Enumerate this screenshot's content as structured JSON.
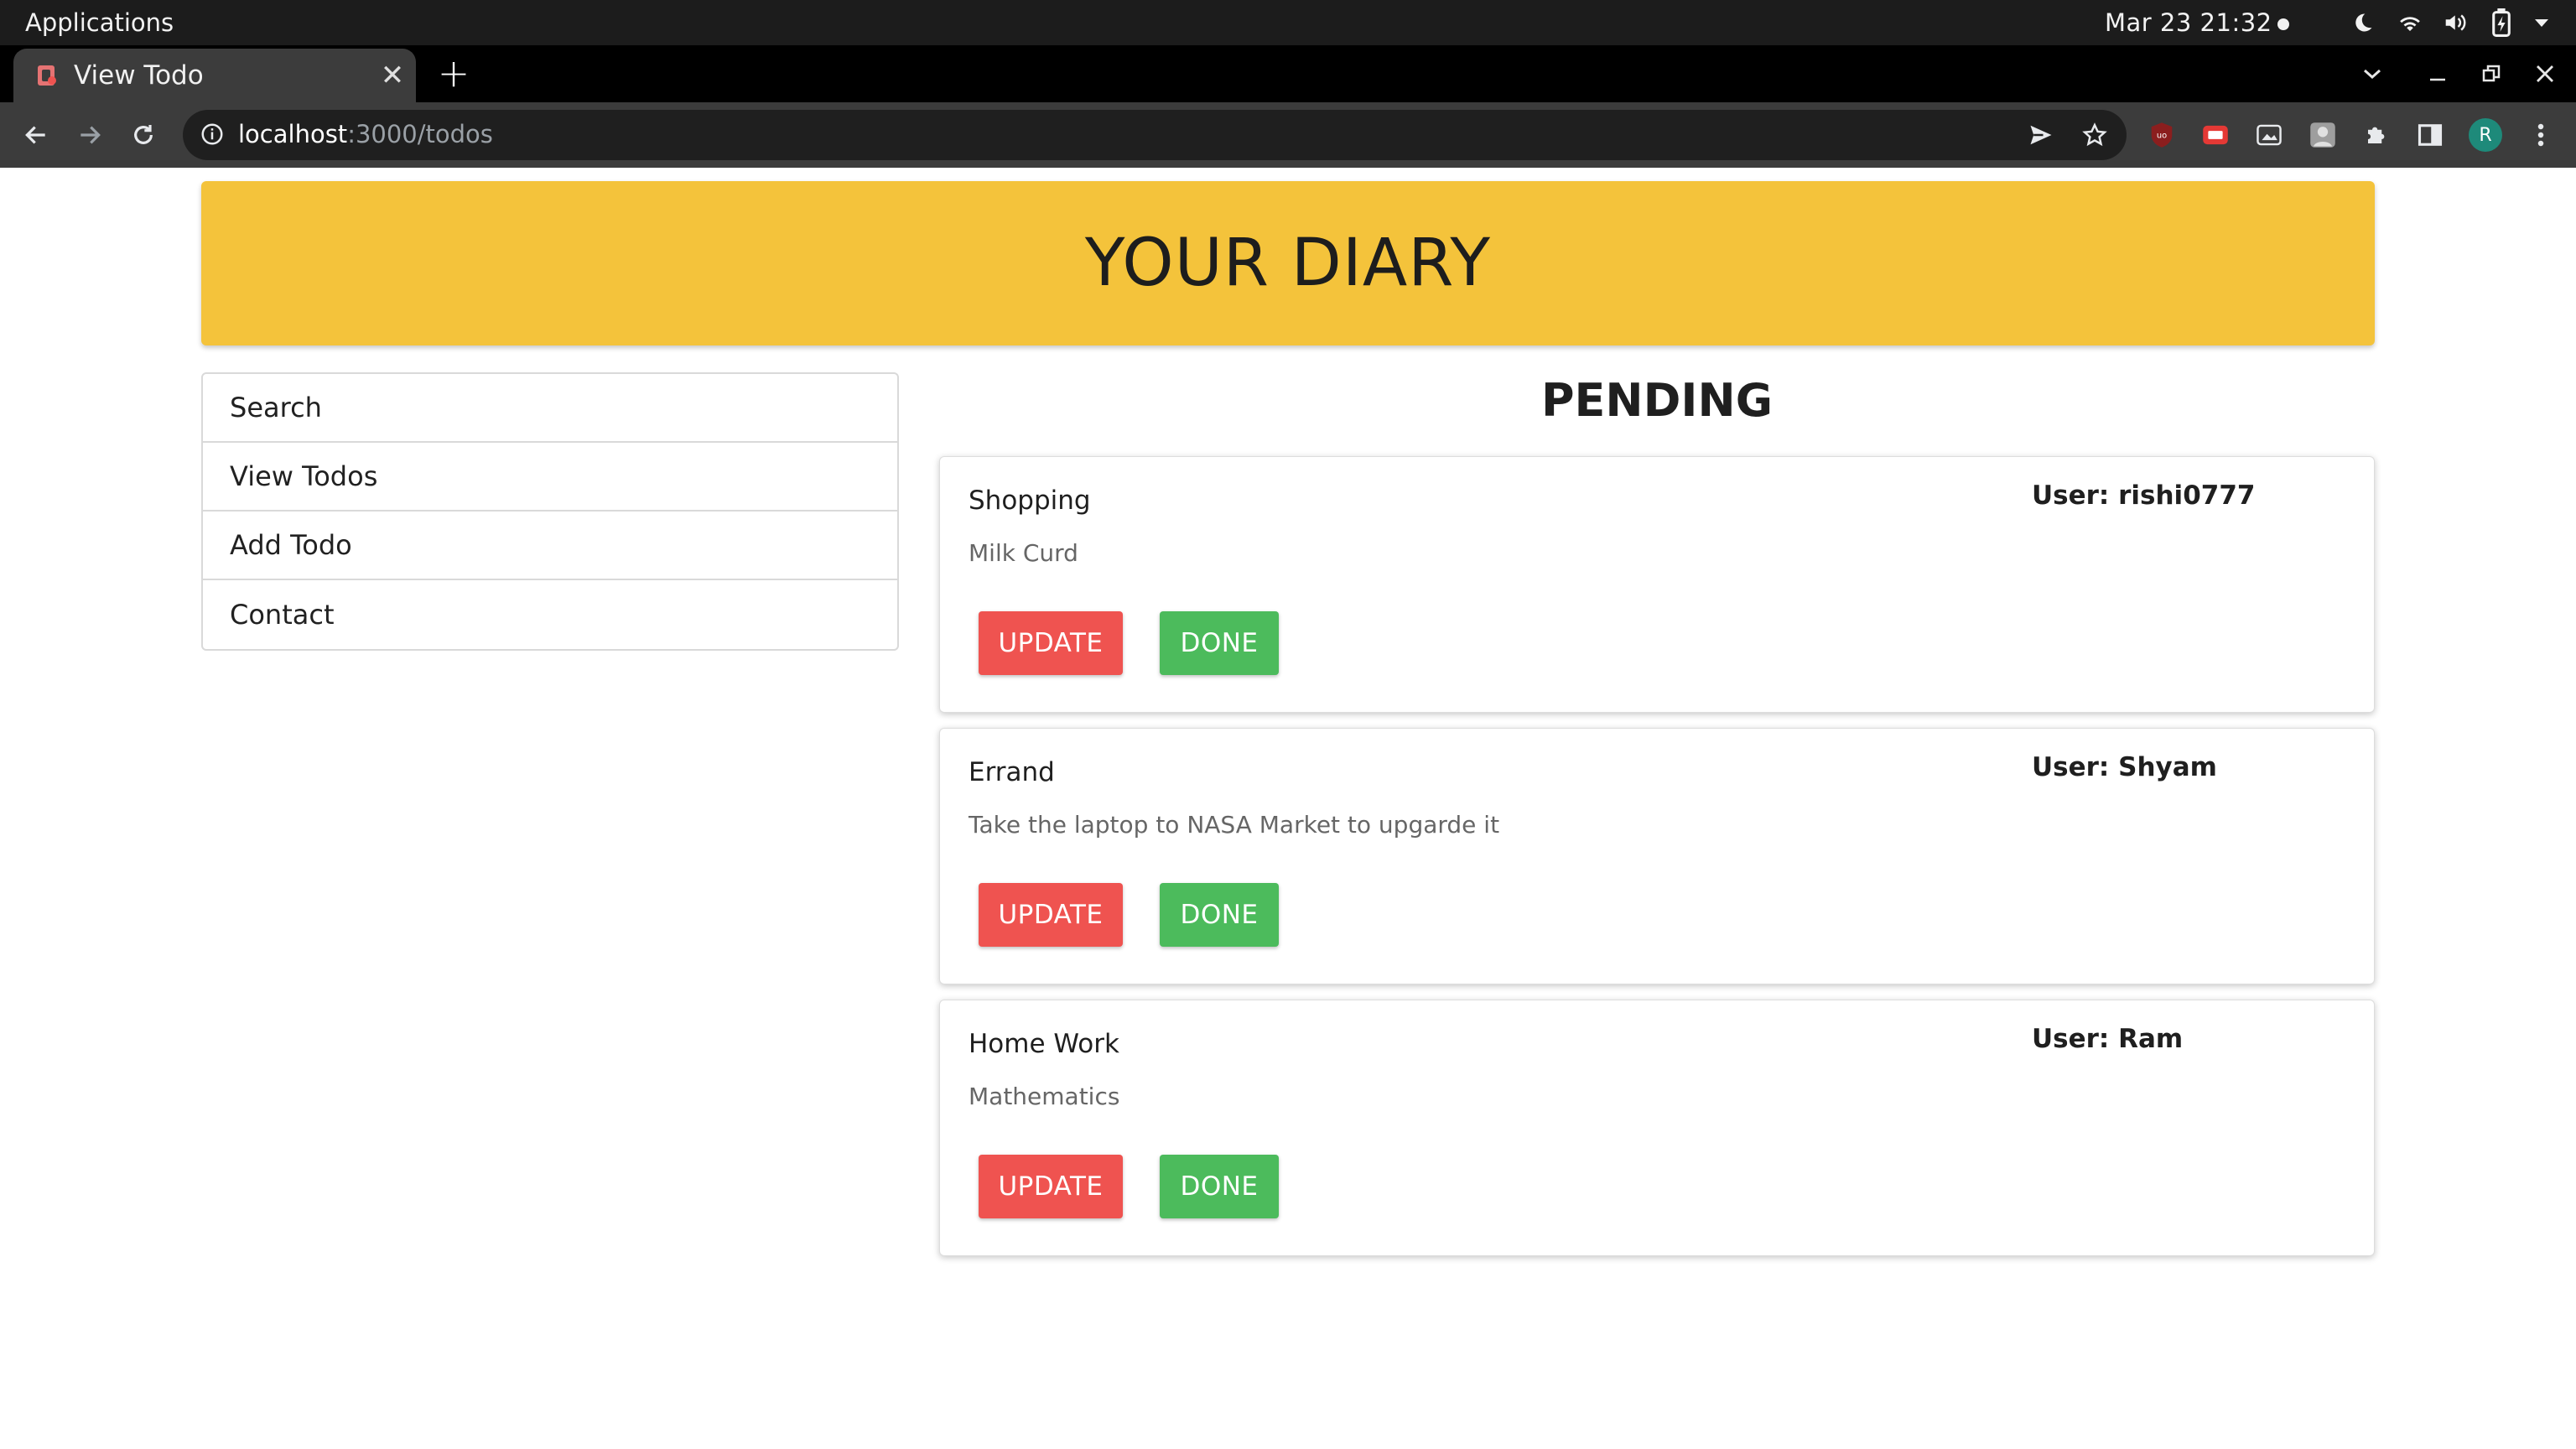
{
  "os": {
    "apps_label": "Applications",
    "clock": "Mar 23  21:32",
    "tray_icons": [
      "night-light-icon",
      "wifi-icon",
      "volume-icon",
      "battery-icon",
      "system-menu-icon"
    ]
  },
  "browser": {
    "tab": {
      "title": "View Todo",
      "close_glyph": "✕"
    },
    "new_tab_glyph": "+",
    "address": {
      "host": "localhost",
      "path": ":3000/todos"
    },
    "avatar_initial": "R",
    "extensions": [
      "ublock-icon",
      "youtube-icon",
      "screenshot-icon",
      "profile-extension-icon",
      "puzzle-icon",
      "side-panel-icon"
    ]
  },
  "page": {
    "header_title": "YOUR DIARY",
    "section_title": "PENDING",
    "sidebar": {
      "items": [
        {
          "label": "Search"
        },
        {
          "label": "View Todos"
        },
        {
          "label": "Add Todo"
        },
        {
          "label": "Contact"
        }
      ]
    },
    "todos": [
      {
        "title": "Shopping",
        "description": "Milk Curd",
        "user": "User: rishi0777",
        "update_label": "UPDATE",
        "done_label": "DONE"
      },
      {
        "title": "Errand",
        "description": "Take the laptop to NASA Market to upgarde it",
        "user": "User: Shyam",
        "update_label": "UPDATE",
        "done_label": "DONE"
      },
      {
        "title": "Home Work",
        "description": "Mathematics",
        "user": "User: Ram",
        "update_label": "UPDATE",
        "done_label": "DONE"
      }
    ]
  },
  "colors": {
    "banner": "#f4c33b",
    "update_button": "#ef5350",
    "done_button": "#4cbb5c"
  }
}
